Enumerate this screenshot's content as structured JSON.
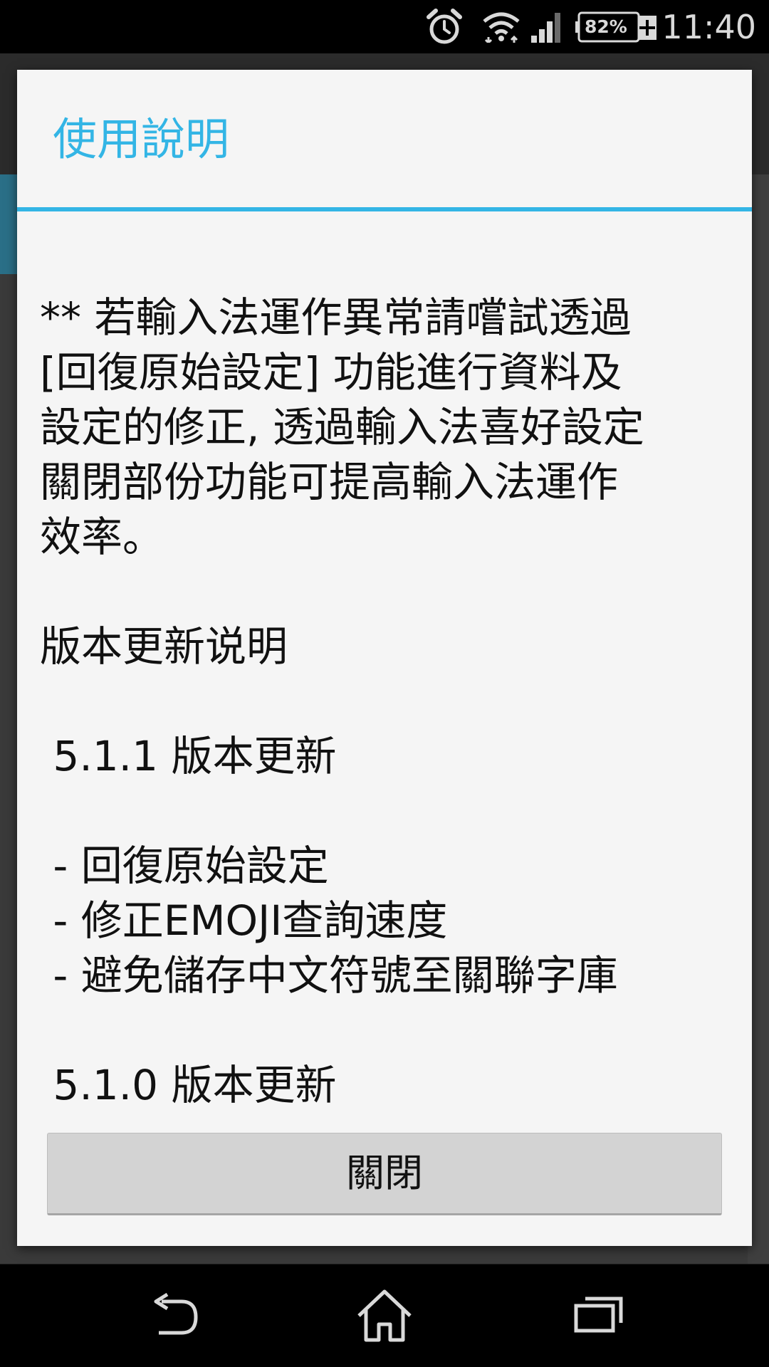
{
  "status_bar": {
    "battery_percent": "82%",
    "time": "11:40"
  },
  "dialog": {
    "title": "使用說明",
    "content_lines": [
      "** 若輸入法運作異常請嚐試透過",
      "[回復原始設定] 功能進行資料及",
      "設定的修正, 透過輸入法喜好設定",
      "關閉部份功能可提高輸入法運作",
      "效率。",
      "",
      "版本更新说明",
      "",
      " 5.1.1 版本更新",
      "",
      " - 回復原始設定",
      " - 修正EMOJI查詢速度",
      " - 避免儲存中文符號至關聯字庫",
      "",
      " 5.1.0 版本更新"
    ],
    "close_button_label": "關閉"
  },
  "colors": {
    "accent": "#33b5e5",
    "dialog_background": "#f5f5f5",
    "button_background": "#d3d3d3"
  },
  "icons": {
    "status": [
      "alarm-icon",
      "wifi-icon",
      "signal-icon",
      "battery-charging-icon"
    ],
    "navigation": [
      "back-icon",
      "home-icon",
      "recent-apps-icon"
    ]
  }
}
